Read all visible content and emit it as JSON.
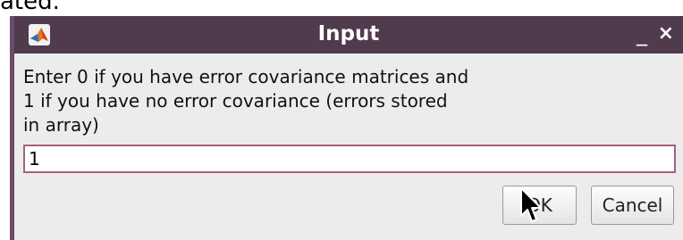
{
  "top_fragment_text": "ated.",
  "dialog": {
    "title": "Input",
    "minimize_glyph": "_",
    "close_glyph": "×",
    "message_lines": [
      "Enter 0 if you have error covariance matrices and",
      "1 if you have no error covariance (errors stored",
      "in array)"
    ],
    "input_value": "1",
    "ok_label": "OK",
    "cancel_label": "Cancel"
  },
  "icons": {
    "app": "matlab-icon",
    "cursor": "mouse-pointer-icon"
  },
  "colors": {
    "titlebar": "#4f3a4e",
    "dialog_body": "#ececec",
    "input_border": "#a65f82"
  }
}
